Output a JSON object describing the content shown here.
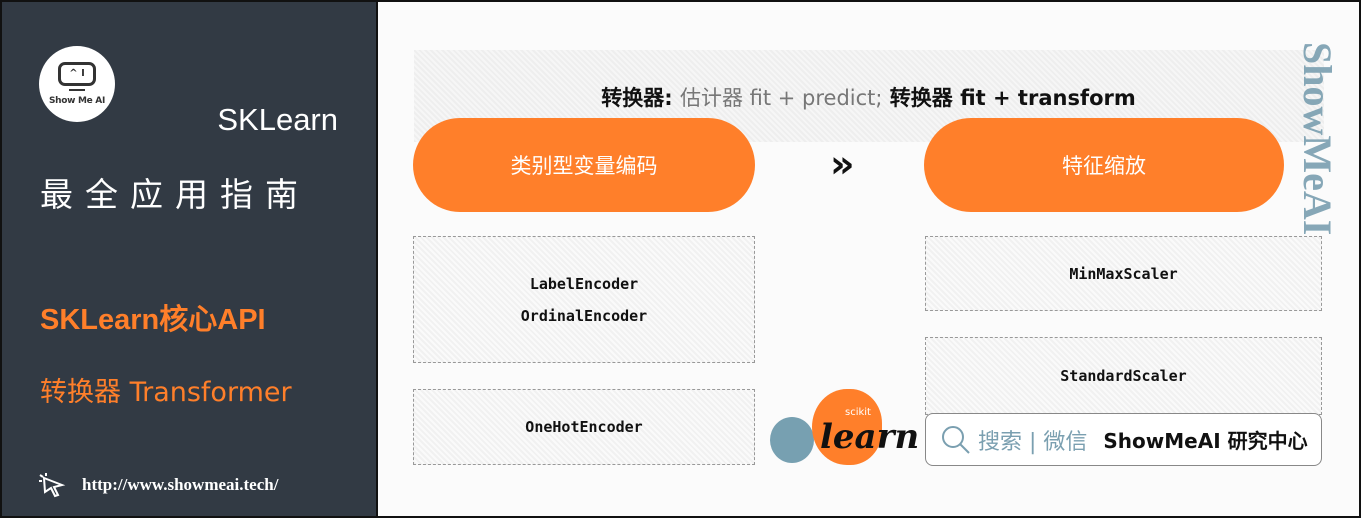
{
  "sidebar": {
    "logo_text": "Show Me AI",
    "logo_face": "^ I",
    "title_en": "SKLearn",
    "title_cn": "最全应用指南",
    "section": "SKLearn核心API",
    "subsection": "转换器 Transformer",
    "url": "http://www.showmeai.tech/"
  },
  "main": {
    "header": {
      "bold1": "转换器:",
      "gray": "估计器 fit + predict;",
      "bold2": "转换器 fit + transform"
    },
    "left_pill": "类别型变量编码",
    "right_pill": "特征缩放",
    "arrow": "»",
    "left_boxes": [
      [
        "LabelEncoder",
        "OrdinalEncoder"
      ],
      [
        "OneHotEncoder"
      ]
    ],
    "right_boxes": [
      [
        "MinMaxScaler"
      ],
      [
        "StandardScaler"
      ]
    ],
    "sklearn_logo": {
      "small": "scikit",
      "big": "learn"
    },
    "search": {
      "label": "搜索 | 微信",
      "brand": "ShowMeAI 研究中心"
    },
    "watermark": "ShowMeAI"
  },
  "colors": {
    "accent": "#ff7f2a",
    "sidebar": "#323a44",
    "blue": "#77a0b1"
  }
}
